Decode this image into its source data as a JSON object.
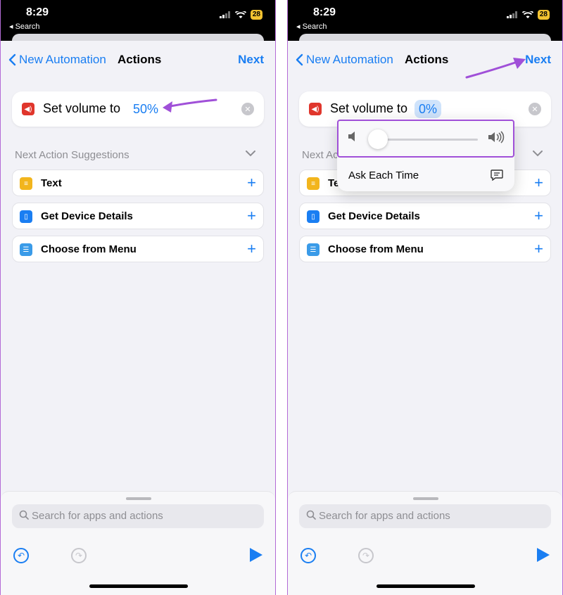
{
  "status": {
    "time": "8:29",
    "back_label": "◂ Search",
    "battery": "28"
  },
  "nav": {
    "back_label": "New Automation",
    "title": "Actions",
    "next_label": "Next"
  },
  "action": {
    "text": "Set volume to",
    "left_value": "50%",
    "right_value": "0%"
  },
  "suggestions": {
    "header": "Next Action Suggestions",
    "items": [
      {
        "label": "Text",
        "icon": "text-icon",
        "color": "#f2b51d"
      },
      {
        "label": "Get Device Details",
        "icon": "device-icon",
        "color": "#1a7ef2"
      },
      {
        "label": "Choose from Menu",
        "icon": "menu-icon",
        "color": "#3a9be8"
      }
    ],
    "truncated_label": "Te",
    "truncated_header": "Next Ac"
  },
  "popover": {
    "ask_label": "Ask Each Time",
    "slider_value": 0
  },
  "search": {
    "placeholder": "Search for apps and actions"
  },
  "colors": {
    "accent": "#1a7ef2",
    "annotation": "#a050d8",
    "speaker_badge": "#e0362c"
  }
}
